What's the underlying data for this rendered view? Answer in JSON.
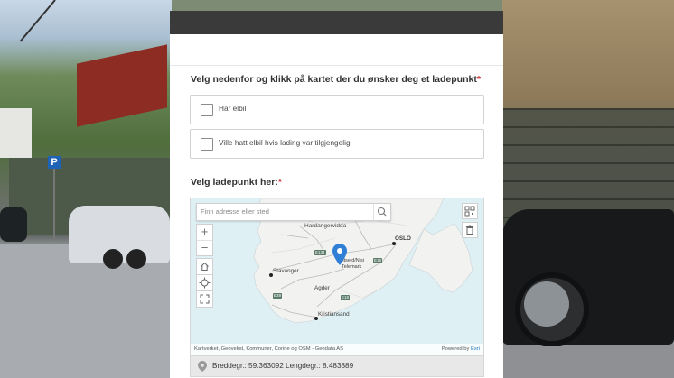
{
  "question1": {
    "label": "Velg nedenfor og klikk på kartet der du ønsker deg et ladepunkt",
    "required_mark": "*",
    "options": [
      {
        "label": "Har elbil",
        "checked": false
      },
      {
        "label": "Ville hatt elbil hvis lading var tilgjengelig",
        "checked": false
      }
    ]
  },
  "question2": {
    "label": "Velg ladepunkt her:",
    "required_mark": "*"
  },
  "map": {
    "search_placeholder": "Finn adresse eller sted",
    "zoom_in": "+",
    "zoom_out": "−",
    "places": {
      "hardangervidda": "Hardangervidda",
      "oslo": "OSLO",
      "stavanger": "Stavanger",
      "telemark": "Telemark",
      "kvitseid": "Kvitseid/Nisi",
      "agder": "Agder",
      "kristiansand": "Kristiansand"
    },
    "road_shields": [
      "E134",
      "E18",
      "E39",
      "E18"
    ],
    "attribution": "Kartverket, Geovekst, Kommuner, Corine og OSM - Geodata AS",
    "powered_by": "Powered by",
    "esri": "Esri",
    "icons": [
      "search-icon",
      "home-icon",
      "locate-icon",
      "fullscreen-icon",
      "qr-icon",
      "trash-icon",
      "map-pin-icon"
    ]
  },
  "coordinates": {
    "text": "Breddegr.: 59.363092  Lengdegr.: 8.483889"
  },
  "colors": {
    "header": "#3a3a3a",
    "required": "#c62828",
    "pin": "#2f7fd6",
    "water": "#dff0f5",
    "land": "#f2f2f0"
  }
}
